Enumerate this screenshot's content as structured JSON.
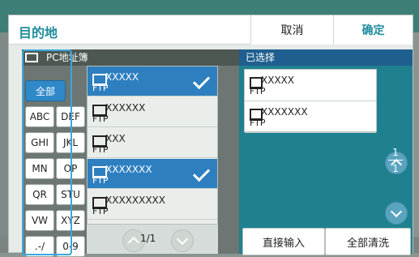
{
  "modal": {
    "title": "目的地",
    "cancel_label": "取消",
    "confirm_label": "确定"
  },
  "left_panel": {
    "header_label": "PC地址簿",
    "filter_keys": [
      "全部",
      "ABC",
      "DEF",
      "GHI",
      "JKL",
      "MN",
      "OP",
      "QR",
      "STU",
      "VW",
      "XYZ",
      ".-/",
      "0-9"
    ],
    "list": [
      {
        "name": "XXXXX",
        "type": "FTP",
        "selected": true
      },
      {
        "name": "XXXXXX",
        "type": "FTP",
        "selected": false
      },
      {
        "name": "XXX",
        "type": "FTP",
        "selected": false
      },
      {
        "name": "XXXXXXX",
        "type": "FTP",
        "selected": true
      },
      {
        "name": "XXXXXXXXX",
        "type": "FTP",
        "selected": false
      }
    ],
    "page_indicator": "1/1"
  },
  "right_panel": {
    "header_label": "已选择",
    "selected_items": [
      {
        "name": "XXXXX",
        "type": "FTP"
      },
      {
        "name": "XXXXXXX",
        "type": "FTP"
      }
    ],
    "page_fraction": {
      "num": "1",
      "den": "1"
    },
    "direct_input_label": "直接输入",
    "clear_all_label": "全部清洗"
  }
}
